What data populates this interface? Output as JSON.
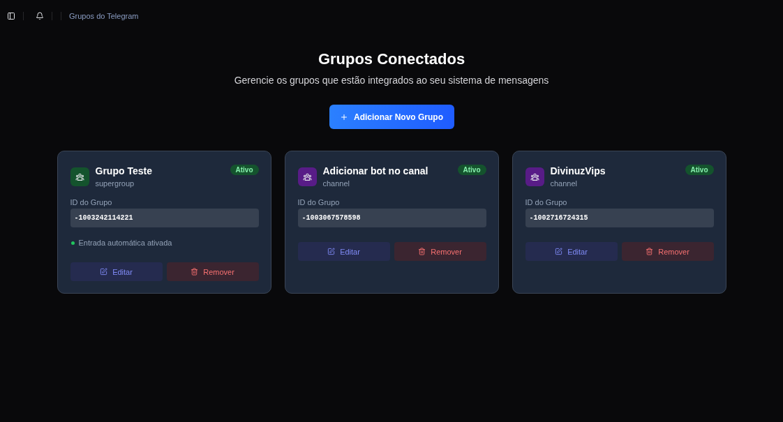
{
  "header": {
    "breadcrumb": "Grupos do Telegram"
  },
  "page": {
    "title": "Grupos Conectados",
    "subtitle": "Gerencie os grupos que estão integrados ao seu sistema de mensagens",
    "add_button": "Adicionar Novo Grupo"
  },
  "groups": [
    {
      "name": "Grupo Teste",
      "type": "supergroup",
      "color": "#14532d",
      "status": "Ativo",
      "active": true,
      "id_label": "ID do Grupo",
      "id_value": "-1003242114221",
      "auto_join": true,
      "auto_join_text": "Entrada automática ativada",
      "edit": "Editar",
      "remove": "Remover"
    },
    {
      "name": "Adicionar bot no canal",
      "type": "channel",
      "color": "#581c87",
      "status": "Ativo",
      "active": true,
      "id_label": "ID do Grupo",
      "id_value": "-1003067578598",
      "edit": "Editar",
      "remove": "Remover"
    },
    {
      "name": "DivinuzVips",
      "type": "channel",
      "color": "#581c87",
      "status": "Ativo",
      "active": true,
      "id_label": "ID do Grupo",
      "id_value": "-1002716724315",
      "edit": "Editar",
      "remove": "Remover"
    }
  ]
}
